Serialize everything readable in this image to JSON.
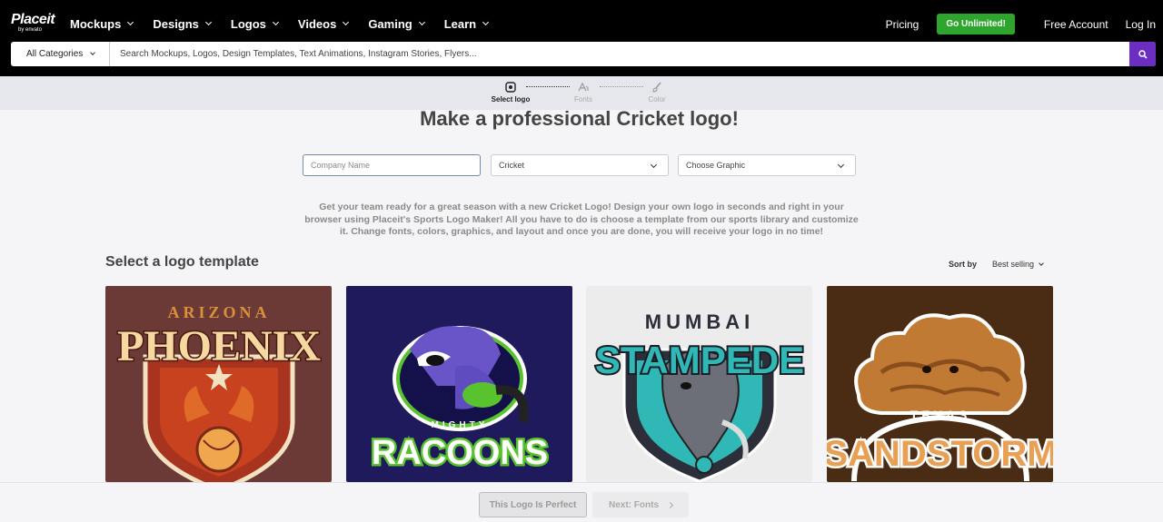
{
  "brand": {
    "name": "Placeit",
    "sub": "by envato"
  },
  "nav": {
    "items": [
      {
        "label": "Mockups"
      },
      {
        "label": "Designs"
      },
      {
        "label": "Logos"
      },
      {
        "label": "Videos"
      },
      {
        "label": "Gaming"
      },
      {
        "label": "Learn"
      }
    ],
    "pricing": "Pricing",
    "go_unlimited": "Go Unlimited!",
    "free_account": "Free Account",
    "login": "Log In"
  },
  "search": {
    "category": "All Categories",
    "placeholder": "Search Mockups, Logos, Design Templates, Text Animations, Instagram Stories, Flyers..."
  },
  "steps": [
    {
      "label": "Select logo",
      "state": "active",
      "icon": "logo-select-icon"
    },
    {
      "label": "Fonts",
      "state": "inactive",
      "icon": "font-icon"
    },
    {
      "label": "Color",
      "state": "inactive",
      "icon": "brush-icon"
    }
  ],
  "page": {
    "title": "Make a professional Cricket logo!",
    "company_placeholder": "Company Name",
    "sport_value": "Cricket",
    "graphic_value": "Choose Graphic",
    "description": "Get your team ready for a great season with a new Cricket Logo! Design your own logo in seconds and right in your browser using Placeit's Sports Logo Maker! All you have to do is choose a template from our sports library and customize it. Change fonts, colors, graphics, and layout and once you are done, you will receive your logo in no time!",
    "section_title": "Select a logo template",
    "sort_label": "Sort by",
    "sort_value": "Best selling"
  },
  "templates": [
    {
      "top": "ARIZONA",
      "name": "PHOENIX",
      "bg": "#6b3a36",
      "accent": "#d9913a"
    },
    {
      "top": "MIGHTY",
      "name": "RACOONS",
      "bg": "#1f1a5c",
      "accent": "#59c32f"
    },
    {
      "top": "MUMBAI",
      "name": "STAMPEDE",
      "bg": "#ececec",
      "accent": "#2fb8b5"
    },
    {
      "top": "TEXAS",
      "name": "SANDSTORM",
      "bg": "#4a2c14",
      "accent": "#e8a055"
    }
  ],
  "footer": {
    "perfect": "This Logo Is Perfect",
    "next": "Next: Fonts"
  },
  "colors": {
    "accent_green": "#2ea52d",
    "search_purple": "#6b2ec1"
  }
}
